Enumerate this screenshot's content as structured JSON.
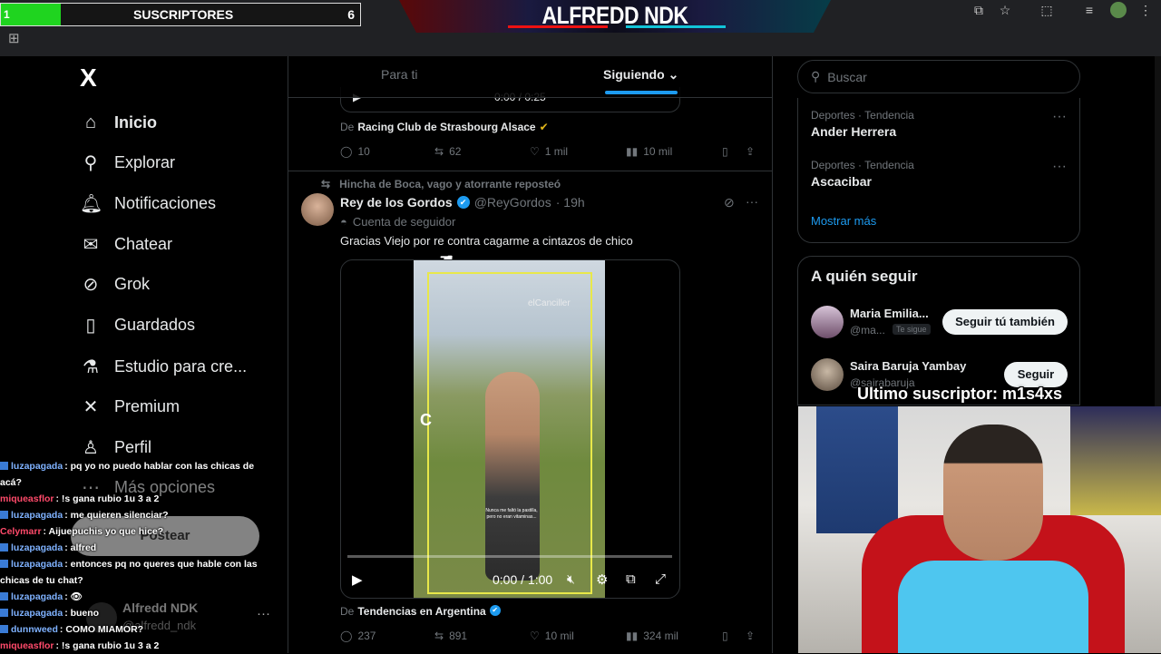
{
  "overlay": {
    "sub_bar_left": "1",
    "sub_bar_label": "SUSCRIPTORES",
    "sub_bar_count": "6",
    "brand": "ALFREDD NDK",
    "last_subscriber": "Ultimo suscriptor: m1s4xs"
  },
  "nav": {
    "logo": "X",
    "items": [
      {
        "label": "Inicio",
        "icon": "home-icon"
      },
      {
        "label": "Explorar",
        "icon": "search-icon"
      },
      {
        "label": "Notificaciones",
        "icon": "bell-icon"
      },
      {
        "label": "Chatear",
        "icon": "mail-icon"
      },
      {
        "label": "Grok",
        "icon": "grok-icon"
      },
      {
        "label": "Guardados",
        "icon": "bookmark-icon"
      },
      {
        "label": "Estudio para cre...",
        "icon": "flask-icon"
      },
      {
        "label": "Premium",
        "icon": "x-icon"
      },
      {
        "label": "Perfil",
        "icon": "person-icon"
      },
      {
        "label": "Más opciones",
        "icon": "more-icon"
      }
    ],
    "post_button": "Postear",
    "account_name": "Alfredd NDK",
    "account_handle": "@alfredd_ndk"
  },
  "chat": [
    {
      "user": "luzapagada",
      "msg": ": pq yo no puedo hablar con las chicas de acá?",
      "color": "#7fb2ff",
      "badge": true
    },
    {
      "user": "miqueasflor",
      "msg": ": !s gana rubio 1u 3 a 2",
      "color": "#ff4a6a",
      "badge": false
    },
    {
      "user": "luzapagada",
      "msg": ": me quieren silenciar?",
      "color": "#7fb2ff",
      "badge": true
    },
    {
      "user": "Celymarr",
      "msg": ": Aijuepuchis yo que hice?",
      "color": "#ff4a6a",
      "badge": false
    },
    {
      "user": "luzapagada",
      "msg": ": alfred",
      "color": "#7fb2ff",
      "badge": true
    },
    {
      "user": "luzapagada",
      "msg": ": entonces pq no queres que hable con las chicas de tu chat?",
      "color": "#7fb2ff",
      "badge": true
    },
    {
      "user": "luzapagada",
      "msg": ": 👁",
      "color": "#7fb2ff",
      "badge": true
    },
    {
      "user": "luzapagada",
      "msg": ": bueno",
      "color": "#7fb2ff",
      "badge": true
    },
    {
      "user": "dunnweed",
      "msg": ": COMO MIAMOR?",
      "color": "#7fb2ff",
      "badge": true
    },
    {
      "user": "miqueasflor",
      "msg": ": !s gana rubio 1u 3 a 2",
      "color": "#ff4a6a",
      "badge": false
    }
  ],
  "feed": {
    "tab_for_you": "Para ti",
    "tab_following": "Siguiendo",
    "prev_post": {
      "from_prefix": "De",
      "from_name": "Racing Club de Strasbourg Alsace",
      "video_time": "0:00 / 0:25",
      "replies": "10",
      "reposts": "62",
      "likes": "1 mil",
      "views": "10 mil"
    },
    "post": {
      "reposted_by": "Hincha de Boca, vago y atorrante reposteó",
      "author_name": "Rey de los Gordos",
      "author_handle": "@ReyGordos",
      "time": "· 19h",
      "parody_label": "Cuenta de seguidor",
      "text": "Gracias Viejo por re contra cagarme a cintazos de chico",
      "video_watermark": "elCanciller",
      "video_caption": "Nunca me faltó la pastilla, pero no eran vitaminas...",
      "video_time": "0:00 / 1:00",
      "from_prefix": "De",
      "from_name": "Tendencias en Argentina",
      "replies": "237",
      "reposts": "891",
      "likes": "10 mil",
      "views": "324 mil"
    }
  },
  "sidebar": {
    "search_placeholder": "Buscar",
    "trends": [
      {
        "meta": "Deportes · Tendencia",
        "name": "Ander Herrera"
      },
      {
        "meta": "Deportes · Tendencia",
        "name": "Ascacibar"
      }
    ],
    "show_more": "Mostrar más",
    "who_to_follow_title": "A quién seguir",
    "suggestions": [
      {
        "name": "Maria Emilia...",
        "handle": "@ma...",
        "badge": "Te sigue",
        "button": "Seguir tú también"
      },
      {
        "name": "Saira Baruja Yambay",
        "handle": "@sairabaruja",
        "badge": "",
        "button": "Seguir"
      }
    ]
  },
  "colors": {
    "accent": "#1d9bf0",
    "background": "#000000",
    "text": "#e7e9ea",
    "muted": "#71767b",
    "sub_bar_fill": "#1fd41f"
  }
}
